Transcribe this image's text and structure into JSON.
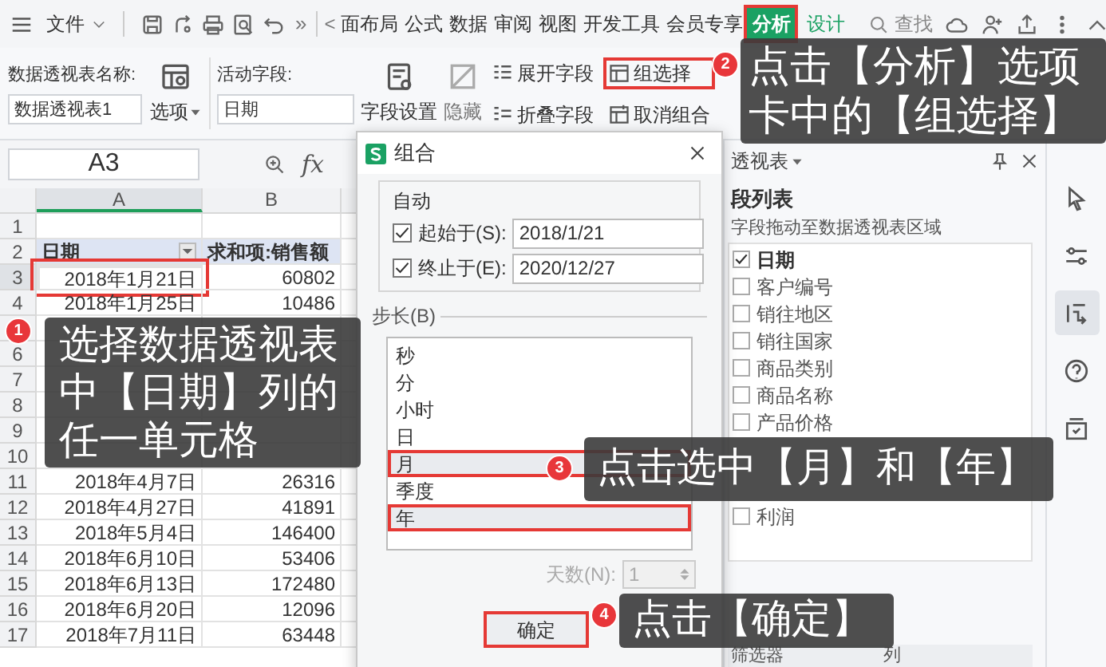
{
  "toolbar": {
    "file_menu": "文件",
    "overflow": "»",
    "scroll_left": "<"
  },
  "tabs": [
    {
      "label": "面布局",
      "kind": "normal",
      "selected": false,
      "highlighted": false
    },
    {
      "label": "公式",
      "kind": "normal",
      "selected": false,
      "highlighted": false
    },
    {
      "label": "数据",
      "kind": "normal",
      "selected": false,
      "highlighted": false
    },
    {
      "label": "审阅",
      "kind": "normal",
      "selected": false,
      "highlighted": false
    },
    {
      "label": "视图",
      "kind": "normal",
      "selected": false,
      "highlighted": false
    },
    {
      "label": "开发工具",
      "kind": "normal",
      "selected": false,
      "highlighted": false
    },
    {
      "label": "会员专享",
      "kind": "normal",
      "selected": false,
      "highlighted": false
    },
    {
      "label": "分析",
      "kind": "context",
      "selected": true,
      "highlighted": true
    },
    {
      "label": "设计",
      "kind": "context",
      "selected": false,
      "highlighted": false
    }
  ],
  "search": {
    "placeholder": "查找"
  },
  "ribbon": {
    "pivot_name": {
      "label": "数据透视表名称:",
      "value": "数据透视表1"
    },
    "options_button": "选项",
    "active_field": {
      "label": "活动字段:",
      "value": "日期"
    },
    "large_buttons": [
      {
        "label": "字段设置",
        "disabled": false
      },
      {
        "label": "隐藏",
        "disabled": true
      }
    ],
    "small_buttons": [
      {
        "label": "展开字段",
        "highlighted": false
      },
      {
        "label": "折叠字段",
        "highlighted": false
      },
      {
        "label": "组选择",
        "highlighted": true
      },
      {
        "label": "取消组合",
        "highlighted": false
      }
    ]
  },
  "formula_bar": {
    "name_box": "A3",
    "fx": "fx"
  },
  "sheet": {
    "columns": [
      {
        "label": "A",
        "selected": true
      },
      {
        "label": "B",
        "selected": false
      }
    ],
    "rows": [
      {
        "num": "1",
        "selected": false,
        "highlighted": false
      },
      {
        "num": "2",
        "kind": "header",
        "date": "日期",
        "sales": "求和项:销售额",
        "selected": false,
        "highlighted": false
      },
      {
        "num": "3",
        "date": "2018年1月21日",
        "sales": "60802",
        "selected": true,
        "highlighted": true
      },
      {
        "num": "4",
        "date": "2018年1月25日",
        "sales": "10486",
        "selected": false,
        "highlighted": false
      },
      {
        "selected": false,
        "highlighted": false
      },
      {
        "num": "6",
        "selected": false,
        "highlighted": false
      },
      {
        "num": "7",
        "selected": false,
        "highlighted": false
      },
      {
        "num": "8",
        "selected": false,
        "highlighted": false
      },
      {
        "num": "9",
        "selected": false,
        "highlighted": false
      },
      {
        "num": "10",
        "selected": false,
        "highlighted": false
      },
      {
        "num": "11",
        "date": "2018年4月7日",
        "sales": "26316",
        "selected": false,
        "highlighted": false
      },
      {
        "num": "12",
        "date": "2018年4月27日",
        "sales": "41891",
        "selected": false,
        "highlighted": false
      },
      {
        "num": "13",
        "date": "2018年5月4日",
        "sales": "146400",
        "selected": false,
        "highlighted": false
      },
      {
        "num": "14",
        "date": "2018年6月10日",
        "sales": "53406",
        "selected": false,
        "highlighted": false
      },
      {
        "num": "15",
        "date": "2018年6月13日",
        "sales": "172480",
        "selected": false,
        "highlighted": false
      },
      {
        "num": "16",
        "date": "2018年6月20日",
        "sales": "12096",
        "selected": false,
        "highlighted": false
      },
      {
        "num": "17",
        "date": "2018年7月11日",
        "sales": "63448",
        "selected": false,
        "highlighted": false
      }
    ]
  },
  "dialog": {
    "title": "组合",
    "legend": "自动",
    "start": {
      "label": "起始于(S):",
      "checked": true,
      "value": "2018/1/21"
    },
    "end": {
      "label": "终止于(E):",
      "checked": true,
      "value": "2020/12/27"
    },
    "step_label": "步长(B)",
    "step_items": [
      {
        "label": "秒",
        "selected": false,
        "highlighted": false
      },
      {
        "label": "分",
        "selected": false,
        "highlighted": false
      },
      {
        "label": "小时",
        "selected": false,
        "highlighted": false
      },
      {
        "label": "日",
        "selected": false,
        "highlighted": false
      },
      {
        "label": "月",
        "selected": true,
        "highlighted": true
      },
      {
        "label": "季度",
        "selected": false,
        "highlighted": false
      },
      {
        "label": "年",
        "selected": true,
        "highlighted": true
      }
    ],
    "days": {
      "label": "天数(N):",
      "value": "1",
      "disabled": true
    },
    "ok_button": {
      "label": "确定",
      "highlighted": true
    }
  },
  "panel": {
    "title": "透视表",
    "section_title": "段列表",
    "hint": "字段拖动至数据透视表区域",
    "fields": [
      {
        "label": "日期",
        "checked": true
      },
      {
        "label": "客户编号",
        "checked": false
      },
      {
        "label": "销往地区",
        "checked": false
      },
      {
        "label": "销往国家",
        "checked": false
      },
      {
        "label": "商品类别",
        "checked": false
      },
      {
        "label": "商品名称",
        "checked": false
      },
      {
        "label": "产品价格",
        "checked": false
      },
      {
        "label": "利润",
        "checked": false
      }
    ],
    "area_labels": [
      "筛选器",
      "列"
    ]
  },
  "side_tools": [
    {
      "selected": false
    },
    {
      "selected": false
    },
    {
      "selected": true
    },
    {
      "selected": false
    },
    {
      "selected": false
    }
  ],
  "callouts": [
    {
      "number": "1",
      "text": "选择数据透视表中【日期】列的任一单元格"
    },
    {
      "number": "2",
      "text": "点击【分析】选项卡中的【组选择】"
    },
    {
      "number": "3",
      "text": "点击选中【月】和【年】"
    },
    {
      "number": "4",
      "text": "点击【确定】"
    }
  ]
}
